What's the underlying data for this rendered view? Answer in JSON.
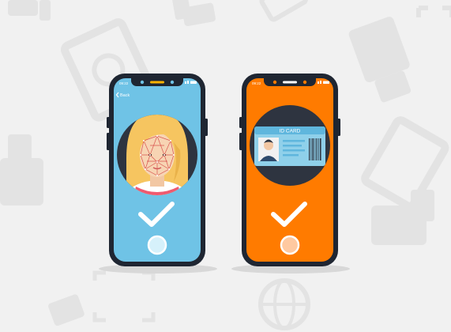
{
  "phone_left": {
    "status_time": "09:22",
    "back_label": "Back",
    "screen_color": "#6fc3e6",
    "frame_color": "#1f2632",
    "verified": true
  },
  "phone_right": {
    "status_time": "09:22",
    "card_title": "ID CARD",
    "screen_color": "#ff7b00",
    "frame_color": "#1f2632",
    "verified": true
  },
  "colors": {
    "background": "#f1f1f1",
    "pattern": "#e2e2e2",
    "circle": "#2e3440",
    "check": "#ffffff"
  },
  "icons": {
    "left_content": "face-scan-icon",
    "right_content": "id-card-icon",
    "verify": "checkmark-icon",
    "home": "home-button-icon"
  }
}
